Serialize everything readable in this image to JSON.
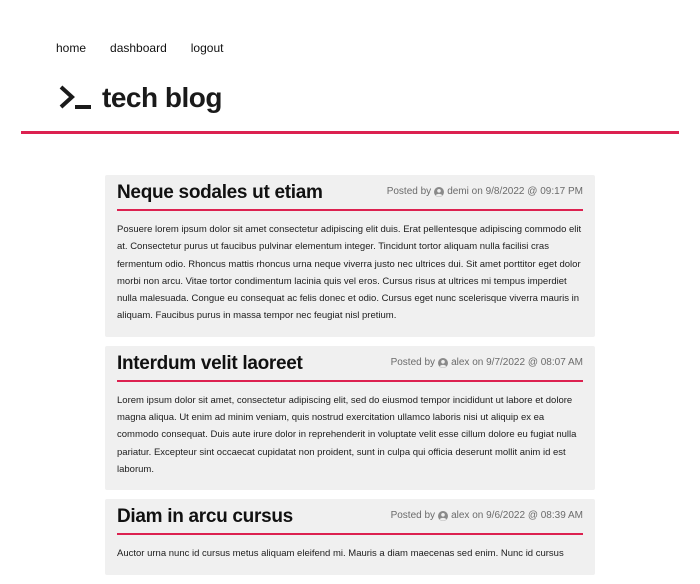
{
  "nav": {
    "home": "home",
    "dashboard": "dashboard",
    "logout": "logout"
  },
  "brand": {
    "title": "tech blog",
    "logo_icon": "terminal-prompt-icon"
  },
  "colors": {
    "accent": "#dc2150",
    "card_bg": "#f0f0f0",
    "meta_text": "#6b6b6b"
  },
  "posts": [
    {
      "title": "Neque sodales ut etiam",
      "posted_by": "Posted by",
      "author": "demi",
      "on": "on",
      "date": "9/8/2022 @ 09:17 PM",
      "body": "Posuere lorem ipsum dolor sit amet consectetur adipiscing elit duis. Erat pellentesque adipiscing commodo elit at. Consectetur purus ut faucibus pulvinar elementum integer. Tincidunt tortor aliquam nulla facilisi cras fermentum odio. Rhoncus mattis rhoncus urna neque viverra justo nec ultrices dui. Sit amet porttitor eget dolor morbi non arcu. Vitae tortor condimentum lacinia quis vel eros. Cursus risus at ultrices mi tempus imperdiet nulla malesuada. Congue eu consequat ac felis donec et odio. Cursus eget nunc scelerisque viverra mauris in aliquam. Faucibus purus in massa tempor nec feugiat nisl pretium."
    },
    {
      "title": "Interdum velit laoreet",
      "posted_by": "Posted by",
      "author": "alex",
      "on": "on",
      "date": "9/7/2022 @ 08:07 AM",
      "body": "Lorem ipsum dolor sit amet, consectetur adipiscing elit, sed do eiusmod tempor incididunt ut labore et dolore magna aliqua. Ut enim ad minim veniam, quis nostrud exercitation ullamco laboris nisi ut aliquip ex ea commodo consequat. Duis aute irure dolor in reprehenderit in voluptate velit esse cillum dolore eu fugiat nulla pariatur. Excepteur sint occaecat cupidatat non proident, sunt in culpa qui officia deserunt mollit anim id est laborum."
    },
    {
      "title": "Diam in arcu cursus",
      "posted_by": "Posted by",
      "author": "alex",
      "on": "on",
      "date": "9/6/2022 @ 08:39 AM",
      "body": "Auctor urna nunc id cursus metus aliquam eleifend mi. Mauris a diam maecenas sed enim. Nunc id cursus"
    }
  ]
}
